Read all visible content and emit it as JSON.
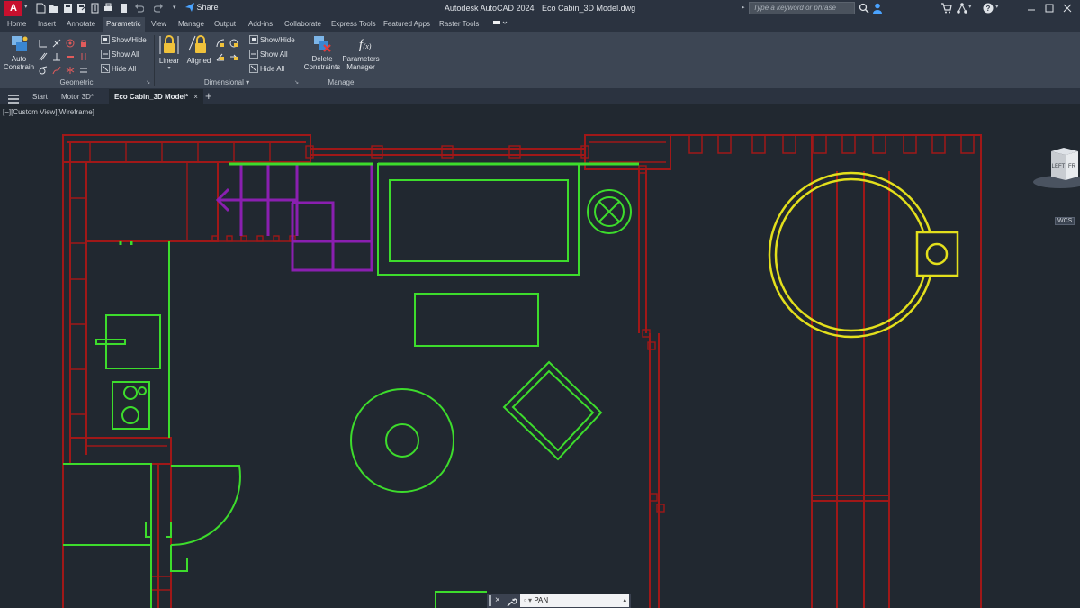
{
  "title_bar": {
    "app_logo": "A",
    "quick_access_icons": [
      "new-icon",
      "open-icon",
      "save-icon",
      "save-as-icon",
      "plot-icon",
      "print-icon",
      "undo-icon",
      "redo-icon",
      "customize-qat-icon"
    ],
    "share_label": "Share",
    "app_name": "Autodesk AutoCAD 2024",
    "file_name": "Eco Cabin_3D Model.dwg",
    "search_placeholder": "Type a keyword or phrase",
    "right_icons": [
      "search-icon",
      "user-icon",
      "cart-icon",
      "connect-icon",
      "help-icon"
    ]
  },
  "ribbon_tabs": [
    {
      "label": "Home",
      "active": false
    },
    {
      "label": "Insert",
      "active": false
    },
    {
      "label": "Annotate",
      "active": false
    },
    {
      "label": "Parametric",
      "active": true
    },
    {
      "label": "View",
      "active": false
    },
    {
      "label": "Manage",
      "active": false
    },
    {
      "label": "Output",
      "active": false
    },
    {
      "label": "Add-ins",
      "active": false
    },
    {
      "label": "Collaborate",
      "active": false
    },
    {
      "label": "Express Tools",
      "active": false
    },
    {
      "label": "Featured Apps",
      "active": false
    },
    {
      "label": "Raster Tools",
      "active": false
    }
  ],
  "ribbon": {
    "geometric": {
      "panel_label": "Geometric",
      "auto_constrain_label": "Auto\nConstrain",
      "show_hide": "Show/Hide",
      "show_all": "Show All",
      "hide_all": "Hide All"
    },
    "dimensional": {
      "panel_label": "Dimensional",
      "linear": "Linear",
      "aligned": "Aligned",
      "show_hide": "Show/Hide",
      "show_all": "Show All",
      "hide_all": "Hide All"
    },
    "manage": {
      "panel_label": "Manage",
      "delete_constraints": "Delete\nConstraints",
      "parameters_manager": "Parameters\nManager"
    }
  },
  "file_tabs": {
    "menu_icon": "hamburger-icon",
    "tabs": [
      {
        "label": "Start",
        "active": false
      },
      {
        "label": "Motor 3D*",
        "active": false
      },
      {
        "label": "Eco Cabin_3D Model*",
        "active": true
      }
    ],
    "close_label": "×",
    "add_label": "+"
  },
  "viewport": {
    "controls_label": "[−][Custom View][Wireframe]",
    "viewcube_labels": [
      "LEFT",
      "FR"
    ],
    "wcs_label": "WCS",
    "colors": {
      "background": "#212830",
      "walls": "#a01818",
      "furniture": "#3ddc2c",
      "stairs": "#8a1fb0",
      "hot_tub": "#e3df1c"
    }
  },
  "command_line": {
    "close_label": "×",
    "value": "PAN"
  }
}
